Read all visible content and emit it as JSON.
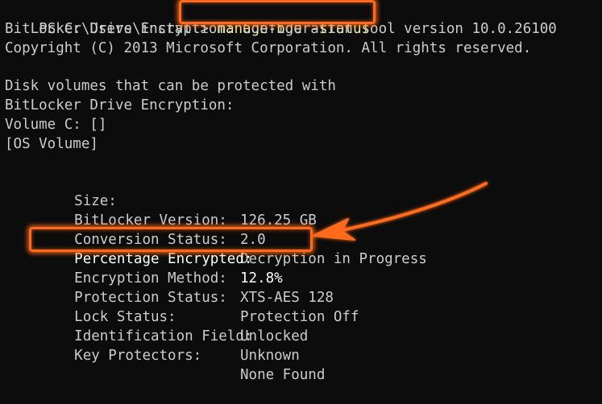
{
  "prompt": {
    "path": "PS C:\\Users\\install",
    "command": "manage-bde -status"
  },
  "header": [
    "BitLocker Drive Encryption: Configuration Tool version 10.0.26100",
    "Copyright (C) 2013 Microsoft Corporation. All rights reserved."
  ],
  "intro": [
    "Disk volumes that can be protected with",
    "BitLocker Drive Encryption:",
    "Volume C: []",
    "[OS Volume]"
  ],
  "properties": [
    {
      "label": "Size:",
      "value": "126.25 GB"
    },
    {
      "label": "BitLocker Version:",
      "value": "2.0"
    },
    {
      "label": "Conversion Status:",
      "value": "Decryption in Progress"
    },
    {
      "label": "Percentage Encrypted:",
      "value": "12.8%"
    },
    {
      "label": "Encryption Method:",
      "value": "XTS-AES 128"
    },
    {
      "label": "Protection Status:",
      "value": "Protection Off"
    },
    {
      "label": "Lock Status:",
      "value": "Unlocked"
    },
    {
      "label": "Identification Field:",
      "value": "Unknown"
    },
    {
      "label": "Key Protectors:",
      "value": "None Found"
    }
  ],
  "colors": {
    "background": "#0c0c0c",
    "text": "#cccccc",
    "command": "#f2f2a0",
    "highlight": "#ff6a1a"
  }
}
